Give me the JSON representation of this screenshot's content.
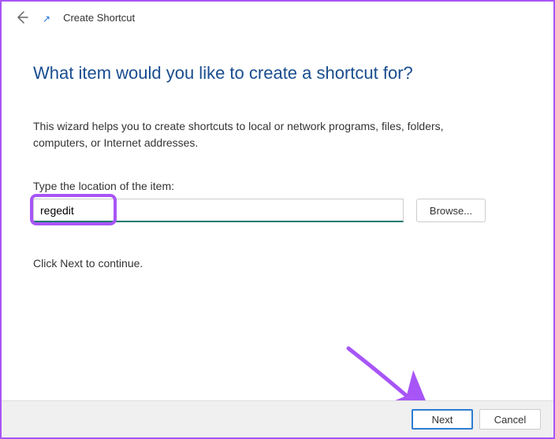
{
  "header": {
    "window_title": "Create Shortcut"
  },
  "content": {
    "heading": "What item would you like to create a shortcut for?",
    "description": "This wizard helps you to create shortcuts to local or network programs, files, folders, computers, or Internet addresses.",
    "field_label": "Type the location of the item:",
    "location_value": "regedit",
    "browse_label": "Browse...",
    "continue_text": "Click Next to continue."
  },
  "footer": {
    "next_label": "Next",
    "cancel_label": "Cancel"
  },
  "colors": {
    "highlight": "#a855f7",
    "heading": "#1a4d8f",
    "input_accent": "#1a7a6f",
    "button_accent": "#2d7dd2"
  }
}
